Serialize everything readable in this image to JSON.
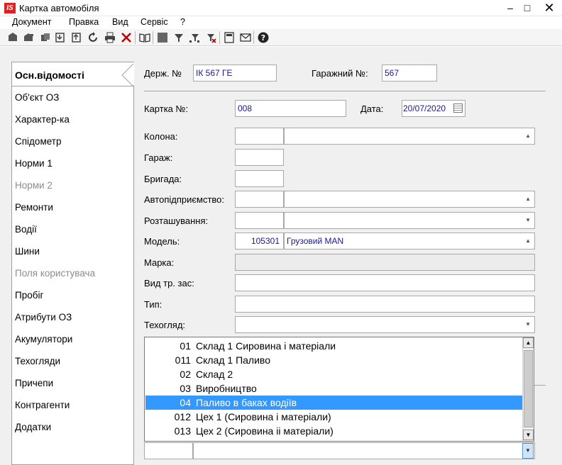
{
  "window": {
    "title": "Картка автомобіля",
    "app_icon_text": "IS",
    "minimize": "–",
    "maximize": "□",
    "close": "✕"
  },
  "menu": [
    "Документ",
    "Правка",
    "Вид",
    "Сервіс",
    "?"
  ],
  "toolbar": {
    "icons": [
      "new-document-icon",
      "open-icon",
      "copy-icon",
      "import-icon",
      "export-icon",
      "refresh-icon",
      "print-icon",
      "delete-icon",
      "book-icon",
      "square-icon",
      "filter-icon",
      "filter-add-icon",
      "filter-clear-icon",
      "calculator-icon",
      "mail-icon",
      "help-icon"
    ]
  },
  "sidenav": {
    "items": [
      {
        "label": "Осн.відомості",
        "active": true,
        "disabled": false
      },
      {
        "label": "Об'єкт ОЗ",
        "active": false,
        "disabled": false
      },
      {
        "label": "Характер-ка",
        "active": false,
        "disabled": false
      },
      {
        "label": "Спідометр",
        "active": false,
        "disabled": false
      },
      {
        "label": "Норми 1",
        "active": false,
        "disabled": false
      },
      {
        "label": "Норми 2",
        "active": false,
        "disabled": true
      },
      {
        "label": "Ремонти",
        "active": false,
        "disabled": false
      },
      {
        "label": "Водії",
        "active": false,
        "disabled": false
      },
      {
        "label": "Шини",
        "active": false,
        "disabled": false
      },
      {
        "label": "Поля користувача",
        "active": false,
        "disabled": true
      },
      {
        "label": "Пробіг",
        "active": false,
        "disabled": false
      },
      {
        "label": "Атрибути ОЗ",
        "active": false,
        "disabled": false
      },
      {
        "label": "Акумулятори",
        "active": false,
        "disabled": false
      },
      {
        "label": "Техогляди",
        "active": false,
        "disabled": false
      },
      {
        "label": "Причепи",
        "active": false,
        "disabled": false
      },
      {
        "label": "Контрагенти",
        "active": false,
        "disabled": false
      },
      {
        "label": "Додатки",
        "active": false,
        "disabled": false
      }
    ]
  },
  "form": {
    "reg_number_label": "Держ. №",
    "reg_number_value": "ІК 567 ГЕ",
    "garage_number_label": "Гаражний №:",
    "garage_number_value": "567",
    "card_label": "Картка №:",
    "card_value": "008",
    "date_label": "Дата:",
    "date_value": "20/07/2020",
    "column_label": "Колона:",
    "garage_label": "Гараж:",
    "brigade_label": "Бригада:",
    "company_label": "Автопідприємство:",
    "location_label": "Розташування:",
    "model_label": "Модель:",
    "model_code": "105301",
    "model_name": "Грузовий MAN",
    "brand_label": "Марка:",
    "vehicle_type_label": "Вид тр. зас:",
    "type_label": "Тип:",
    "inspection_label": "Техогляд:"
  },
  "dropdown": {
    "rows": [
      {
        "code": "01",
        "name": "Склад 1 Сировина і матеріали",
        "selected": false
      },
      {
        "code": "011",
        "name": "Склад 1 Паливо",
        "selected": false
      },
      {
        "code": "02",
        "name": "Склад 2",
        "selected": false
      },
      {
        "code": "03",
        "name": "Виробництво",
        "selected": false
      },
      {
        "code": "04",
        "name": "Паливо в баках водіїв",
        "selected": true
      },
      {
        "code": "012",
        "name": "Цех 1 (Сировина і матеріали)",
        "selected": false
      },
      {
        "code": "013",
        "name": "Цех 2 (Сировина іі  матеріали)",
        "selected": false
      }
    ]
  },
  "colors": {
    "selection": "#3399ff",
    "field_text": "#1a1a8a",
    "disabled_text": "#8c8c8c"
  }
}
